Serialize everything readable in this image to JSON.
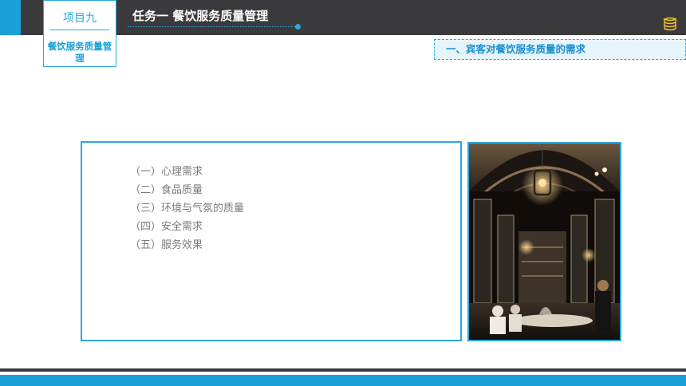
{
  "header": {
    "project_label": "项目九",
    "project_subtitle": "餐饮服务质量管理",
    "task_title": "任务一  餐饮服务质量管理",
    "logo_icon": "book-stack-icon"
  },
  "section": {
    "heading": "一、宾客对餐饮服务质量的需求"
  },
  "content": {
    "items": [
      "（一）心理需求",
      "（二）食品质量",
      "（三）环境与气氛的质量",
      "（四）安全需求",
      "（五）服务效果"
    ]
  },
  "colors": {
    "accent_blue": "#1aa0d8",
    "header_dark": "#3a3a3c",
    "heading_bg": "#e6f4fb",
    "list_text": "#7a7a7a"
  }
}
